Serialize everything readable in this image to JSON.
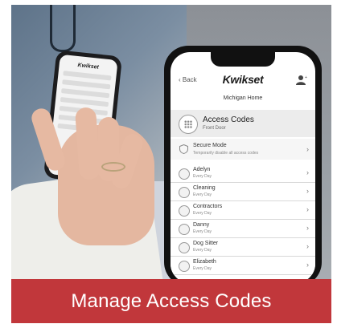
{
  "banner": {
    "text": "Manage Access Codes",
    "color": "#c1373b"
  },
  "main_phone": {
    "nav": {
      "back_label": "Back",
      "brand": "Kwikset",
      "user_icon": "user-icon"
    },
    "home_name": "Michigan Home",
    "section": {
      "title": "Access Codes",
      "subtitle": "Front Door",
      "icon": "keypad-icon"
    },
    "secure_mode": {
      "label": "Secure Mode",
      "sublabel": "Temporarily disable all access codes"
    },
    "codes": [
      {
        "name": "Adelyn",
        "sub": "Every Day"
      },
      {
        "name": "Cleaning",
        "sub": "Every Day"
      },
      {
        "name": "Contractors",
        "sub": "Every Day"
      },
      {
        "name": "Danny",
        "sub": "Every Day"
      },
      {
        "name": "Dog Sitter",
        "sub": "Every Day"
      },
      {
        "name": "Elizabeth",
        "sub": "Every Day"
      }
    ]
  },
  "back_phone": {
    "brand": "Kwikset"
  }
}
